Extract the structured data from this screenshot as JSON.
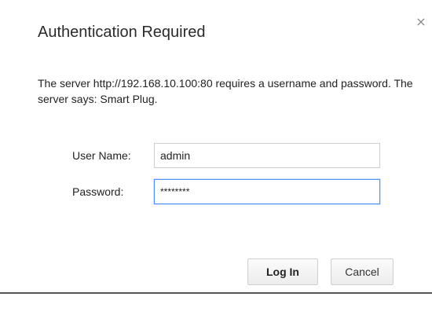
{
  "dialog": {
    "title": "Authentication Required",
    "close_glyph": "×",
    "message": "The server http://192.168.10.100:80 requires a username and password. The server says: Smart Plug.",
    "fields": {
      "username": {
        "label": "User Name:",
        "value": "admin"
      },
      "password": {
        "label": "Password:",
        "value": "********"
      }
    },
    "buttons": {
      "login": "Log In",
      "cancel": "Cancel"
    }
  },
  "icons": {
    "close": "close-icon"
  },
  "colors": {
    "focus_border": "#4d90fe",
    "title_text": "#2b2b2b"
  }
}
